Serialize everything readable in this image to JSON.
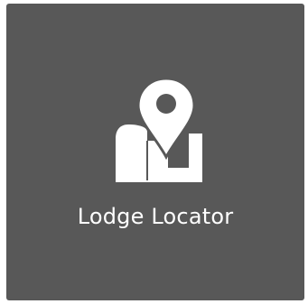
{
  "tile": {
    "label": "Lodge Locator",
    "icon": "map-pin-icon",
    "background": "#585858",
    "foreground": "#ffffff"
  }
}
